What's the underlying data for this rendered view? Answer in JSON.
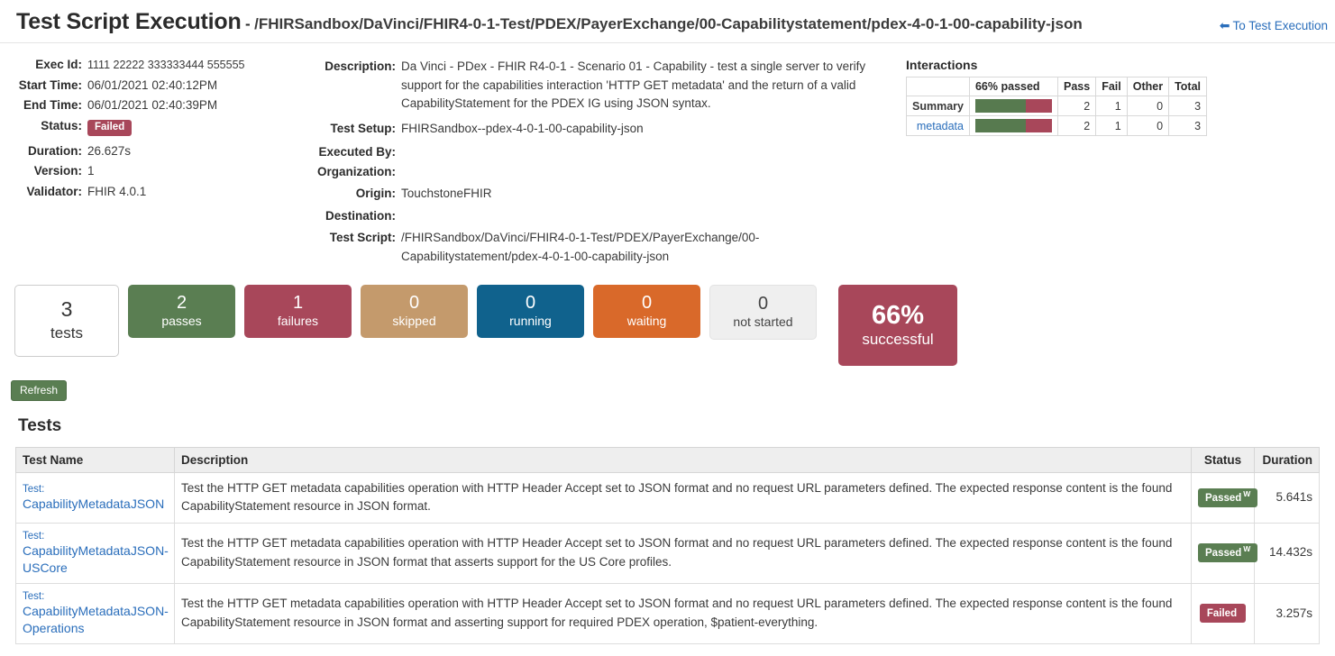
{
  "header": {
    "title": "Test Script Execution",
    "separator": "-",
    "subtitle": "/FHIRSandbox/DaVinci/FHIR4-0-1-Test/PDEX/PayerExchange/00-Capabilitystatement/pdex-4-0-1-00-capability-json",
    "back_link": "To Test Execution",
    "back_arrow": "left-arrow-icon"
  },
  "meta_left": {
    "labels": {
      "exec_id": "Exec Id:",
      "start_time": "Start Time:",
      "end_time": "End Time:",
      "status": "Status:",
      "duration": "Duration:",
      "version": "Version:",
      "validator": "Validator:"
    },
    "values": {
      "exec_id": "1111 22222 333333444 555555",
      "start_time": "06/01/2021 02:40:12PM",
      "end_time": "06/01/2021 02:40:39PM",
      "status": "Failed",
      "duration": "26.627s",
      "version": "1",
      "validator": "FHIR 4.0.1"
    }
  },
  "meta_mid": {
    "labels": {
      "description": "Description:",
      "test_setup": "Test Setup:",
      "executed_by": "Executed By:",
      "organization": "Organization:",
      "origin": "Origin:",
      "destination": "Destination:",
      "test_script": "Test Script:"
    },
    "values": {
      "description": "Da Vinci - PDex - FHIR R4-0-1 - Scenario 01 - Capability - test a single server to verify support for the capabilities interaction 'HTTP GET metadata' and the return of a valid CapabilityStatement for the PDEX IG using JSON syntax.",
      "test_setup": "FHIRSandbox--pdex-4-0-1-00-capability-json",
      "executed_by": "",
      "organization": "",
      "origin": "TouchstoneFHIR",
      "destination": "",
      "test_script": "/FHIRSandbox/DaVinci/FHIR4-0-1-Test/PDEX/PayerExchange/00-Capabilitystatement/pdex-4-0-1-00-capability-json"
    }
  },
  "interactions": {
    "heading": "Interactions",
    "columns": [
      "",
      "66% passed",
      "Pass",
      "Fail",
      "Other",
      "Total"
    ],
    "rows": [
      {
        "label": "Summary",
        "is_link": false,
        "pass": "2",
        "fail": "1",
        "other": "0",
        "total": "3",
        "pass_pct": 66
      },
      {
        "label": "metadata",
        "is_link": true,
        "pass": "2",
        "fail": "1",
        "other": "0",
        "total": "3",
        "pass_pct": 66
      }
    ],
    "bar_colors": {
      "pass": "#577a4f",
      "fail": "#a8475a"
    }
  },
  "tiles": [
    {
      "num": "3",
      "label": "tests",
      "kind": "tests"
    },
    {
      "num": "2",
      "label": "passes",
      "kind": "passes"
    },
    {
      "num": "1",
      "label": "failures",
      "kind": "failures"
    },
    {
      "num": "0",
      "label": "skipped",
      "kind": "skipped"
    },
    {
      "num": "0",
      "label": "running",
      "kind": "running"
    },
    {
      "num": "0",
      "label": "waiting",
      "kind": "waiting"
    },
    {
      "num": "0",
      "label": "not started",
      "kind": "notstarted"
    },
    {
      "num": "66%",
      "label": "successful",
      "kind": "successful"
    }
  ],
  "refresh_label": "Refresh",
  "tests_heading": "Tests",
  "tests_table": {
    "columns": [
      "Test Name",
      "Description",
      "Status",
      "Duration"
    ],
    "rows": [
      {
        "name_prefix": "Test:",
        "name": "CapabilityMetadataJSON",
        "description": "Test the HTTP GET metadata capabilities operation with HTTP Header Accept set to JSON format and no request URL parameters defined. The expected response content is the found CapabilityStatement resource in JSON format.",
        "status": "Passed",
        "status_sup": "W",
        "status_kind": "passed",
        "duration": "5.641s"
      },
      {
        "name_prefix": "Test:",
        "name": "CapabilityMetadataJSON-USCore",
        "description": "Test the HTTP GET metadata capabilities operation with HTTP Header Accept set to JSON format and no request URL parameters defined. The expected response content is the found CapabilityStatement resource in JSON format that asserts support for the US Core profiles.",
        "status": "Passed",
        "status_sup": "W",
        "status_kind": "passed",
        "duration": "14.432s"
      },
      {
        "name_prefix": "Test:",
        "name": "CapabilityMetadataJSON-Operations",
        "description": "Test the HTTP GET metadata capabilities operation with HTTP Header Accept set to JSON format and no request URL parameters defined. The expected response content is the found CapabilityStatement resource in JSON format and asserting support for required PDEX operation, $patient-everything.",
        "status": "Failed",
        "status_sup": "",
        "status_kind": "failed",
        "duration": "3.257s"
      }
    ]
  },
  "colors": {
    "green": "#5a7e52",
    "maroon": "#a8475a",
    "tan": "#c49a6c",
    "blue": "#10628d",
    "orange": "#d9692a",
    "link": "#2a6ebb"
  }
}
